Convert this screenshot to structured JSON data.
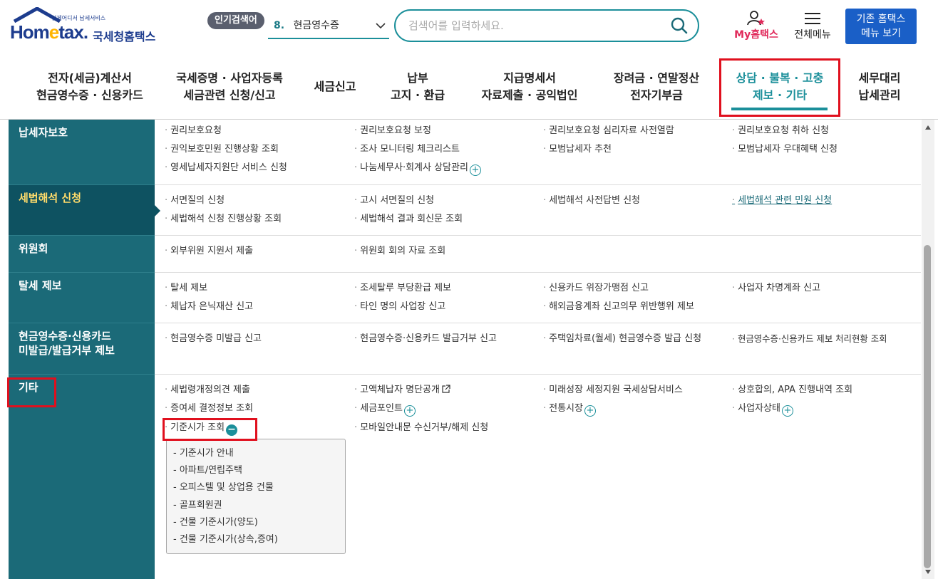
{
  "header": {
    "logo": {
      "tagline": "언제어디서 납세서비스",
      "brand_en_prefix": "Hom",
      "brand_en_e": "e",
      "brand_en_suffix": "tax.",
      "brand_kr": "국세청홈택스"
    },
    "popular": {
      "badge": "인기검색어",
      "rank": "8.",
      "term": "현금영수증"
    },
    "search": {
      "placeholder": "검색어를 입력하세요."
    },
    "my_hometax": "My홈택스",
    "all_menu": "전체메뉴",
    "legacy_btn_line1": "기존 홈택스",
    "legacy_btn_line2": "메뉴 보기"
  },
  "gnb": [
    {
      "line1": "전자(세금)계산서",
      "line2": "현금영수증 · 신용카드"
    },
    {
      "line1": "국세증명 · 사업자등록",
      "line2": "세금관련 신청/신고"
    },
    {
      "line1": "세금신고",
      "line2": ""
    },
    {
      "line1": "납부",
      "line2": "고지 · 환급"
    },
    {
      "line1": "지급명세서",
      "line2": "자료제출 · 공익법인"
    },
    {
      "line1": "장려금 · 연말정산",
      "line2": "전자기부금"
    },
    {
      "line1": "상담 · 불복 · 고충",
      "line2": "제보 · 기타"
    },
    {
      "line1": "세무대리",
      "line2": "납세관리"
    }
  ],
  "categories": [
    {
      "label": "납세자보호",
      "links": [
        "권리보호요청",
        "권리보호요청 보정",
        "권리보호요청 심리자료 사전열람",
        "권리보호요청 취하 신청",
        "권익보호민원 진행상황 조회",
        "조사 모니터링 체크리스트",
        "모범납세자 추천",
        "모범납세자 우대혜택 신청",
        "영세납세자지원단 서비스 신청",
        "나눔세무사·회계사 상담관리"
      ]
    },
    {
      "label": "세법해석 신청",
      "links": [
        "서면질의 신청",
        "고시 서면질의 신청",
        "세법해석 사전답변 신청",
        "세법해석 관련 민원 신청",
        "세법해석 신청 진행상황 조회",
        "세법해석 결과 회신문 조회"
      ]
    },
    {
      "label": "위원회",
      "links": [
        "외부위원 지원서 제출",
        "위원회 회의 자료 조회"
      ]
    },
    {
      "label": "탈세 제보",
      "links": [
        "탈세 제보",
        "조세탈루 부당환급 제보",
        "신용카드 위장가맹점 신고",
        "사업자 차명계좌 신고",
        "체납자 은닉재산 신고",
        "타인 명의 사업장 신고",
        "해외금융계좌 신고의무 위반행위 제보"
      ]
    },
    {
      "label_line1": "현금영수증·신용카드",
      "label_line2": "미발급/발급거부 제보",
      "links": [
        "현금영수증 미발급 신고",
        "현금영수증·신용카드 발급거부 신고",
        "주택임차료(월세) 현금영수증 발급 신청",
        "현금영수증·신용카드 제보 처리현황 조회"
      ]
    },
    {
      "label": "기타",
      "links": [
        "세법령개정의견 제출",
        "고액체납자 명단공개",
        "미래성장 세정지원 국세상담서비스",
        "상호합의, APA 진행내역 조회",
        "증여세 결정정보 조회",
        "세금포인트",
        "전통시장",
        "사업자상태",
        "기준시가 조회",
        "모바일안내문 수신거부/해제 신청"
      ]
    }
  ],
  "submenu": [
    "- 기준시가 안내",
    "- 아파트/연립주택",
    "- 오피스텔 및 상업용 건물",
    "- 골프회원권",
    "- 건물 기준시가(양도)",
    "- 건물 기준시가(상속,증여)"
  ],
  "colors": {
    "teal": "#1b6a78",
    "teal_active": "#0e5261",
    "accent": "#1b8f9a",
    "highlight_box": "#e0101e",
    "active_label": "#ffdc6b",
    "legacy_btn": "#1a5fc7"
  }
}
